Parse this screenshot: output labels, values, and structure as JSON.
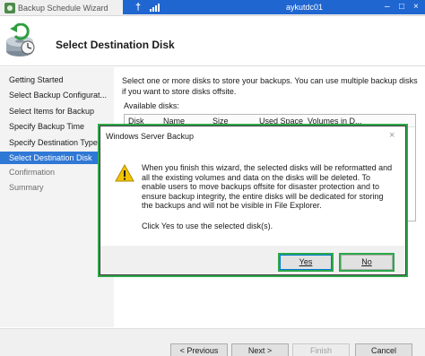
{
  "window": {
    "title": "Backup Schedule Wizard"
  },
  "remote_bar": {
    "host": "aykutdc01",
    "pin_icon": "pin-icon",
    "signal_icon": "signal-strength-icon",
    "minimize": "–",
    "restore": "□",
    "close": "×"
  },
  "header": {
    "title": "Select Destination Disk",
    "icon": "backup-disk-icon"
  },
  "nav": {
    "items": [
      {
        "label": "Getting Started",
        "state": "normal"
      },
      {
        "label": "Select Backup Configurat...",
        "state": "normal"
      },
      {
        "label": "Select Items for Backup",
        "state": "normal"
      },
      {
        "label": "Specify Backup Time",
        "state": "normal"
      },
      {
        "label": "Specify Destination Type",
        "state": "normal"
      },
      {
        "label": "Select Destination Disk",
        "state": "active"
      },
      {
        "label": "Confirmation",
        "state": "disabled"
      },
      {
        "label": "Summary",
        "state": "disabled"
      }
    ]
  },
  "main": {
    "description": "Select one or more disks to store your backups. You can use multiple backup disks if you want to store disks offsite.",
    "available_label": "Available disks:",
    "columns": [
      "Disk",
      "Name",
      "Size",
      "Used Space",
      "Volumes in D..."
    ]
  },
  "dialog": {
    "title": "Windows Server Backup",
    "message": "When you finish this wizard, the selected disks will be reformatted and all the existing volumes and data on the disks will be deleted. To enable users to move backups offsite for disaster protection and to ensure backup integrity, the entire disks will be dedicated for storing the backups and will not be visible in File Explorer.",
    "confirm": "Click Yes to use the selected disk(s).",
    "yes_label": "Yes",
    "no_label": "No",
    "close": "×",
    "icon": "warning-icon",
    "highlight_color": "#2ea84a"
  },
  "footer": {
    "previous_label": "< Previous",
    "next_label": "Next >",
    "finish_label": "Finish",
    "cancel_label": "Cancel"
  },
  "colors": {
    "accent": "#3078d6",
    "remote_bar": "#1f66d1",
    "highlight": "#2ea84a",
    "warning": "#f4c300"
  }
}
